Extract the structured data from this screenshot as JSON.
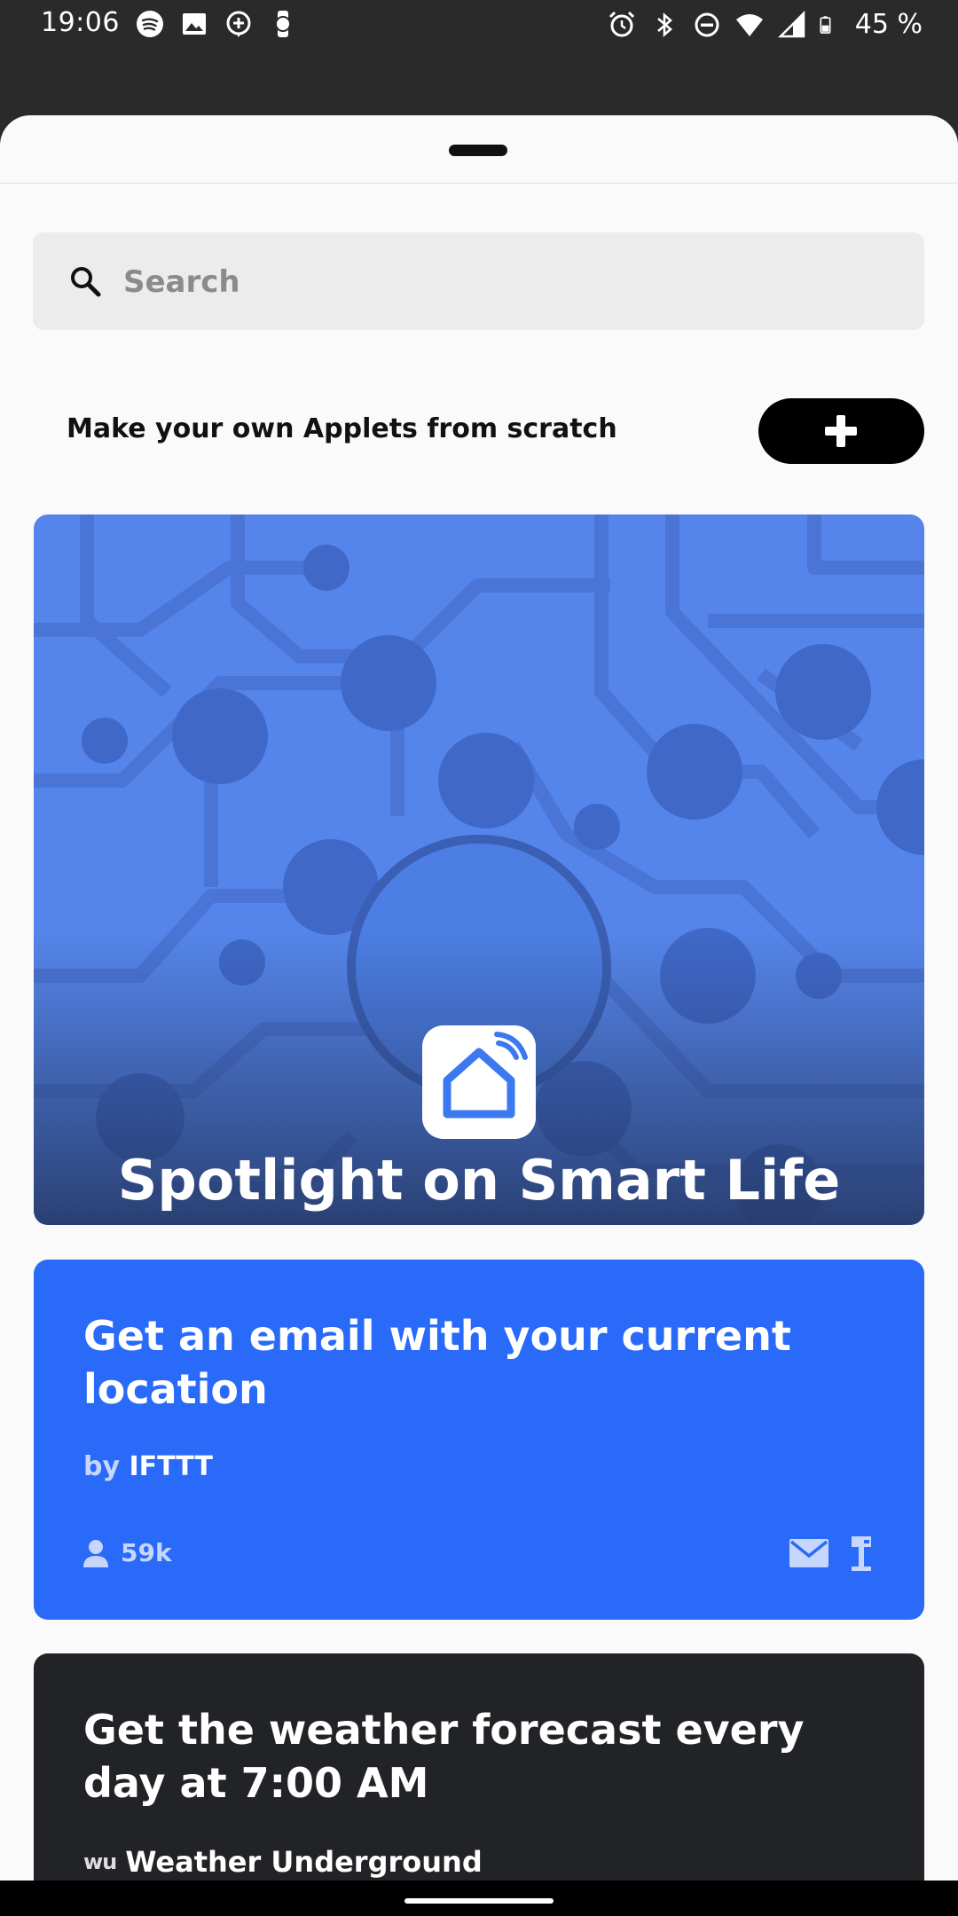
{
  "status_bar": {
    "time": "19:06",
    "left_icons": [
      "spotify-icon",
      "image-icon",
      "message-icon",
      "watch-icon"
    ],
    "right_icons": [
      "alarm-icon",
      "bluetooth-icon",
      "dnd-icon",
      "wifi-icon",
      "signal-icon",
      "battery-icon"
    ],
    "battery": "45 %"
  },
  "search": {
    "placeholder": "Search"
  },
  "create": {
    "label": "Make your own Applets from scratch"
  },
  "spotlight": {
    "title": "Spotlight on Smart Life",
    "accent": "#5585ea"
  },
  "applets": [
    {
      "title": "Get an email with your current location",
      "author_prefix": "by",
      "author": "IFTTT",
      "users": "59k",
      "services": [
        "email-icon",
        "location-pin-icon"
      ],
      "color": "#2a6af9"
    },
    {
      "title": "Get the weather forecast every day at 7:00 AM",
      "service_logo": "wu",
      "service": "Weather Underground",
      "color": "#222326"
    }
  ]
}
